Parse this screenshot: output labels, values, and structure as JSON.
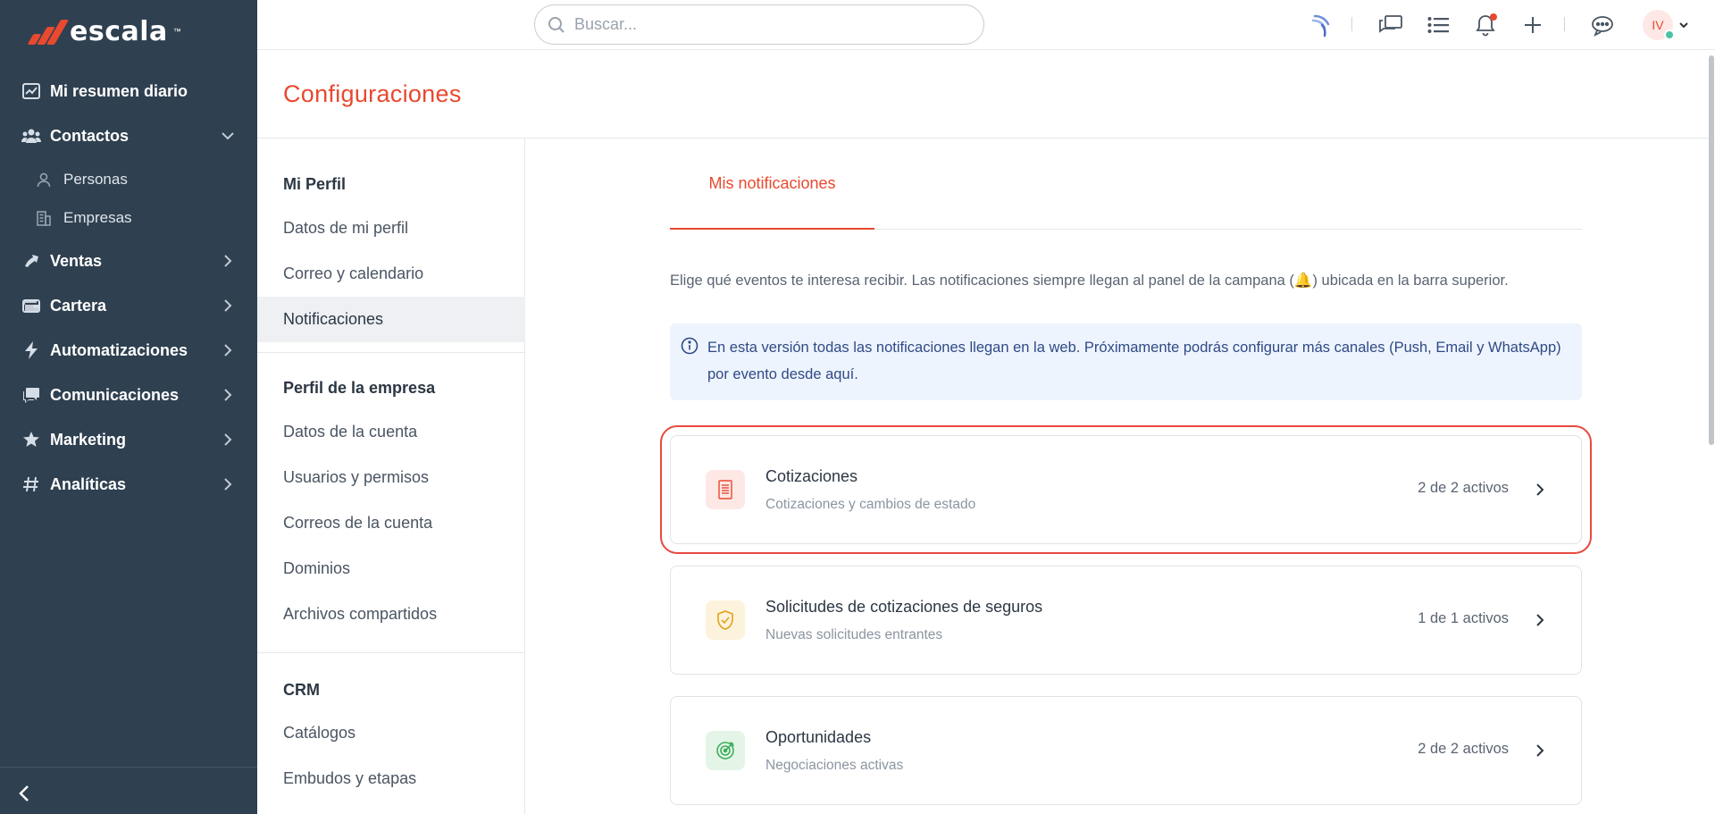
{
  "brand": {
    "name": "escala",
    "tm": "™"
  },
  "sidebar": {
    "items": [
      {
        "label": "Mi resumen diario",
        "icon": "chart-icon"
      },
      {
        "label": "Contactos",
        "icon": "contacts-icon",
        "expanded": true
      },
      {
        "label": "Ventas",
        "icon": "sales-icon"
      },
      {
        "label": "Cartera",
        "icon": "wallet-icon"
      },
      {
        "label": "Automatizaciones",
        "icon": "bolt-icon"
      },
      {
        "label": "Comunicaciones",
        "icon": "chat-icon"
      },
      {
        "label": "Marketing",
        "icon": "star-icon"
      },
      {
        "label": "Analíticas",
        "icon": "hash-icon"
      }
    ],
    "subitems": [
      {
        "label": "Personas",
        "icon": "person-icon"
      },
      {
        "label": "Empresas",
        "icon": "building-icon"
      }
    ]
  },
  "topbar": {
    "search_placeholder": "Buscar...",
    "avatar_initials": "IV"
  },
  "page": {
    "title": "Configuraciones"
  },
  "settings_nav": {
    "sections": [
      {
        "title": "Mi Perfil",
        "items": [
          "Datos de mi perfil",
          "Correo y calendario",
          "Notificaciones"
        ]
      },
      {
        "title": "Perfil de la empresa",
        "items": [
          "Datos de la cuenta",
          "Usuarios y permisos",
          "Correos de la cuenta",
          "Dominios",
          "Archivos compartidos"
        ]
      },
      {
        "title": "CRM",
        "items": [
          "Catálogos",
          "Embudos y etapas"
        ]
      }
    ],
    "active": "Notificaciones"
  },
  "main": {
    "tab": "Mis notificaciones",
    "description": "Elige qué eventos te interesa recibir. Las notificaciones siempre llegan al panel de la campana (🔔) ubicada en la barra superior.",
    "info": "En esta versión todas las notificaciones llegan en la web. Próximamente podrás configurar más canales (Push, Email y WhatsApp) por evento desde aquí.",
    "cards": [
      {
        "title": "Cotizaciones",
        "subtitle": "Cotizaciones y cambios de estado",
        "count": "2 de 2 activos",
        "icon": "document-icon",
        "icon_bg": "#fde8e6",
        "icon_color": "#e8492f"
      },
      {
        "title": "Solicitudes de cotizaciones de seguros",
        "subtitle": "Nuevas solicitudes entrantes",
        "count": "1 de 1 activos",
        "icon": "shield-check-icon",
        "icon_bg": "#fdf3dc",
        "icon_color": "#e0a21c"
      },
      {
        "title": "Oportunidades",
        "subtitle": "Negociaciones activas",
        "count": "2 de 2 activos",
        "icon": "target-icon",
        "icon_bg": "#e4f5e8",
        "icon_color": "#3fae5c"
      }
    ]
  },
  "colors": {
    "accent": "#e8492f",
    "sidebar_bg": "#2f4050",
    "info_bg": "#eef4fd",
    "info_text": "#2f4a86"
  }
}
